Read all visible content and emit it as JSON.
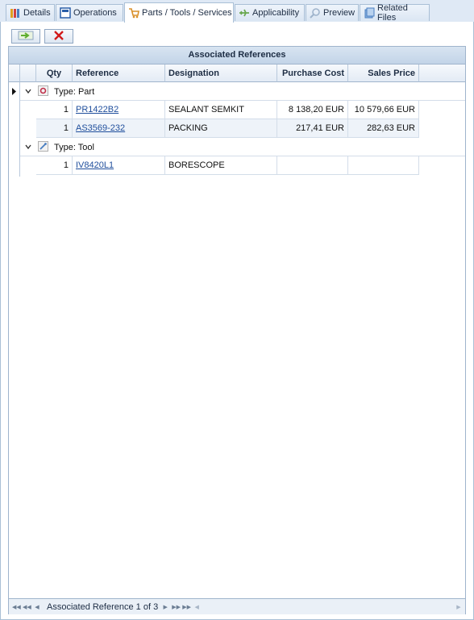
{
  "tabs": [
    {
      "label": "Details",
      "icon": "details-icon"
    },
    {
      "label": "Operations",
      "icon": "operations-icon"
    },
    {
      "label": "Parts / Tools / Services",
      "icon": "cart-icon",
      "active": true
    },
    {
      "label": "Applicability",
      "icon": "plane-icon"
    },
    {
      "label": "Preview",
      "icon": "preview-icon"
    },
    {
      "label": "Related Files",
      "icon": "files-icon"
    }
  ],
  "toolbar": {
    "add_icon": "add-arrow-icon",
    "delete_icon": "delete-x-icon"
  },
  "grid": {
    "band_title": "Associated References",
    "columns": {
      "qty": "Qty",
      "reference": "Reference",
      "designation": "Designation",
      "purchase_cost": "Purchase Cost",
      "sales_price": "Sales Price"
    },
    "groups": [
      {
        "label": "Type: Part",
        "rows": [
          {
            "qty": "1",
            "reference": "PR1422B2",
            "designation": "SEALANT SEMKIT",
            "purchase_cost": "8 138,20 EUR",
            "sales_price": "10 579,66 EUR"
          },
          {
            "qty": "1",
            "reference": "AS3569-232",
            "designation": "PACKING",
            "purchase_cost": "217,41 EUR",
            "sales_price": "282,63 EUR"
          }
        ]
      },
      {
        "label": "Type: Tool",
        "rows": [
          {
            "qty": "1",
            "reference": "IV8420L1",
            "designation": "BORESCOPE",
            "purchase_cost": "",
            "sales_price": ""
          }
        ]
      }
    ]
  },
  "pager": {
    "text": "Associated Reference 1 of 3"
  },
  "colors": {
    "tab_bg": "#dfe9f5",
    "header_bg": "#c3d4e8",
    "link": "#1f4e9c",
    "delete": "#d11a1a",
    "add": "#5fae2e"
  }
}
